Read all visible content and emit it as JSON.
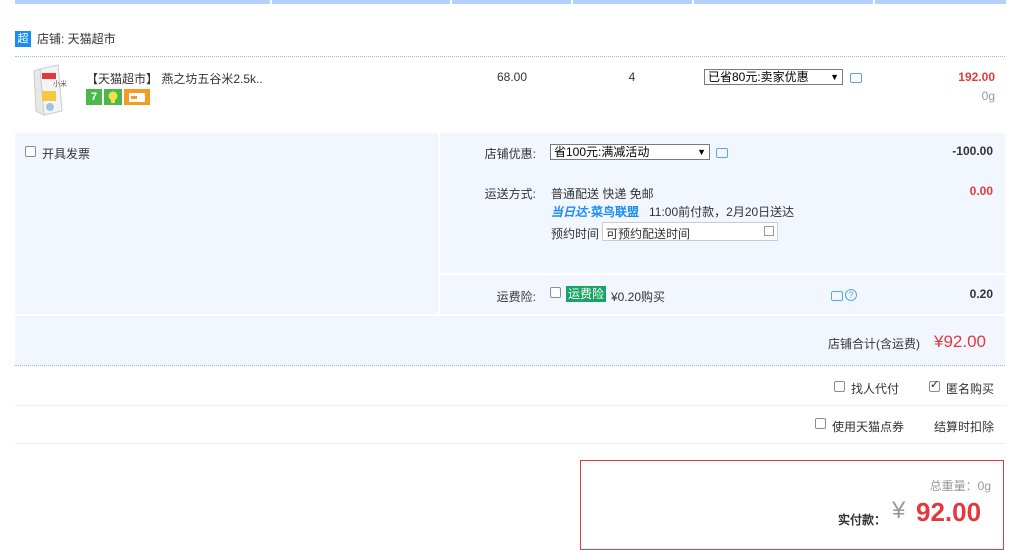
{
  "shop": {
    "badge": "超",
    "label": "店铺: 天猫超市"
  },
  "item": {
    "title": "【天猫超市】 燕之坊五谷米2.5k..",
    "price": "68.00",
    "quantity": "4",
    "promo_select": "已省80元:卖家优惠",
    "subtotal": "192.00",
    "weight": "0g",
    "badge_seven": "7",
    "image_text": "小米"
  },
  "invoice": {
    "label": "开具发票"
  },
  "store_discount": {
    "label": "店铺优惠:",
    "select": "省100元:满减活动",
    "amount": "-100.00"
  },
  "shipping": {
    "label": "运送方式:",
    "method": "普通配送 快递 免邮",
    "partner_a": "当日达",
    "dot": "·",
    "partner_b": "菜鸟联盟",
    "promise": "11:00前付款，2月20日送达",
    "appoint_label": "预约时间",
    "appoint_placeholder": "可预约配送时间",
    "amount": "0.00"
  },
  "insurance": {
    "label": "运费险:",
    "badge": "运费险",
    "price": "¥0.20购买",
    "amount": "0.20",
    "help": "?"
  },
  "shop_total": {
    "label": "店铺合计(含运费)",
    "currency": "¥",
    "amount": "92.00"
  },
  "options": {
    "proxy_pay": "找人代付",
    "anonymous": "匿名购买",
    "tmall_points": "使用天猫点券",
    "deduct_note": "结算时扣除"
  },
  "summary": {
    "weight_label": "总重量：",
    "weight": "0g",
    "pay_label": "实付款：",
    "currency": "¥",
    "amount": "92.00"
  },
  "colors": {
    "accent_red": "#e4393c",
    "accent_blue": "#1b8bf5",
    "panel_bg": "#f2f7ff"
  }
}
